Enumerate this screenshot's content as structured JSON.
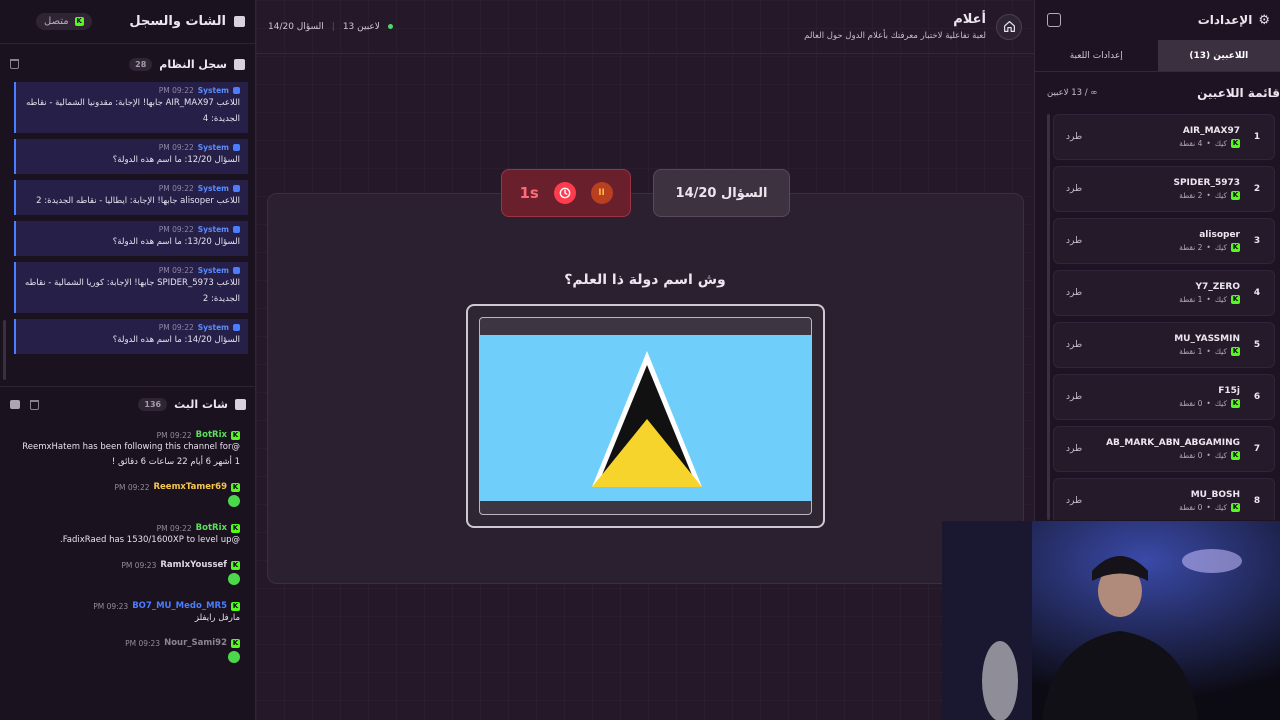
{
  "left_panel": {
    "title": "الشات والسجل",
    "status": "متصل",
    "syslog": {
      "title": "سجل النظام",
      "count": "28",
      "messages": [
        {
          "sender": "System",
          "time": "09:22 PM",
          "text": "اللاعب AIR_MAX97 جابها! الإجابة: مقدونيا الشمالية - نقاطه الجديدة: 4"
        },
        {
          "sender": "System",
          "time": "09:22 PM",
          "text": "السؤال 12/20: ما اسم هذه الدولة؟"
        },
        {
          "sender": "System",
          "time": "09:22 PM",
          "text": "اللاعب alisoper جابها! الإجابة: ايطاليا - نقاطه الجديدة: 2"
        },
        {
          "sender": "System",
          "time": "09:22 PM",
          "text": "السؤال 13/20: ما اسم هذه الدولة؟"
        },
        {
          "sender": "System",
          "time": "09:22 PM",
          "text": "اللاعب SPIDER_5973 جابها! الإجابة: كوريا الشمالية - نقاطه الجديدة: 2"
        },
        {
          "sender": "System",
          "time": "09:22 PM",
          "text": "السؤال 14/20: ما اسم هذه الدولة؟"
        }
      ]
    },
    "chat": {
      "title": "شات البث",
      "count": "136",
      "messages": [
        {
          "user": "BotRix",
          "time": "09:22 PM",
          "color": "#5ae05a",
          "text": "@ReemxHatem has been following this channel for 1 أشهر 6 أيام 22 ساعات 6 دقائق !",
          "emoji": false
        },
        {
          "user": "ReemxTamer69",
          "time": "09:22 PM",
          "color": "#f5c84c",
          "text": "",
          "emoji": true
        },
        {
          "user": "BotRix",
          "time": "09:22 PM",
          "color": "#5ae05a",
          "text": "@FadixRaed has 1530/1600XP to level up.",
          "emoji": false
        },
        {
          "user": "RamIxYoussef",
          "time": "09:23 PM",
          "color": "#e0d6e6",
          "text": "",
          "emoji": true
        },
        {
          "user": "BO7_MU_Medo_MR5",
          "time": "09:23 PM",
          "color": "#4a7dff",
          "text": "مارفل رايفلز",
          "emoji": false
        },
        {
          "user": "Nour_Sami92",
          "time": "09:23 PM",
          "color": "#8c8492",
          "text": "",
          "emoji": true
        }
      ]
    }
  },
  "center": {
    "game_title": "أعلام",
    "game_subtitle": "لعبة تفاعلية لاختبار معرفتك بأعلام الدول حول العالم",
    "players_online": "13 لاعبين",
    "question_progress": "السؤال 14/20",
    "question_label": "السؤال 14/20",
    "timer": "1s",
    "question_text": "وش اسم دولة ذا العلم؟",
    "flag": "saint-lucia-flag"
  },
  "right_panel": {
    "title": "الإعدادات",
    "tabs": [
      "اللاعبين (13)",
      "إعدادات اللعبة"
    ],
    "list_title": "قائمة اللاعبين",
    "list_count": "∞ / 13 لاعبين",
    "kick_label": "طرد",
    "platform": "كيك",
    "players": [
      {
        "rank": "1",
        "name": "AIR_MAX97",
        "points": "4 نقطة"
      },
      {
        "rank": "2",
        "name": "SPIDER_5973",
        "points": "2 نقطة"
      },
      {
        "rank": "3",
        "name": "alisoper",
        "points": "2 نقطة"
      },
      {
        "rank": "4",
        "name": "Y7_ZERO",
        "points": "1 نقطة"
      },
      {
        "rank": "5",
        "name": "MU_YASSMIN",
        "points": "1 نقطة"
      },
      {
        "rank": "6",
        "name": "F15j",
        "points": "0 نقطة"
      },
      {
        "rank": "7",
        "name": "AB_MARK_ABN_ABGAMING",
        "points": "0 نقطة"
      },
      {
        "rank": "8",
        "name": "MU_BOSH",
        "points": "0 نقطة"
      }
    ]
  }
}
